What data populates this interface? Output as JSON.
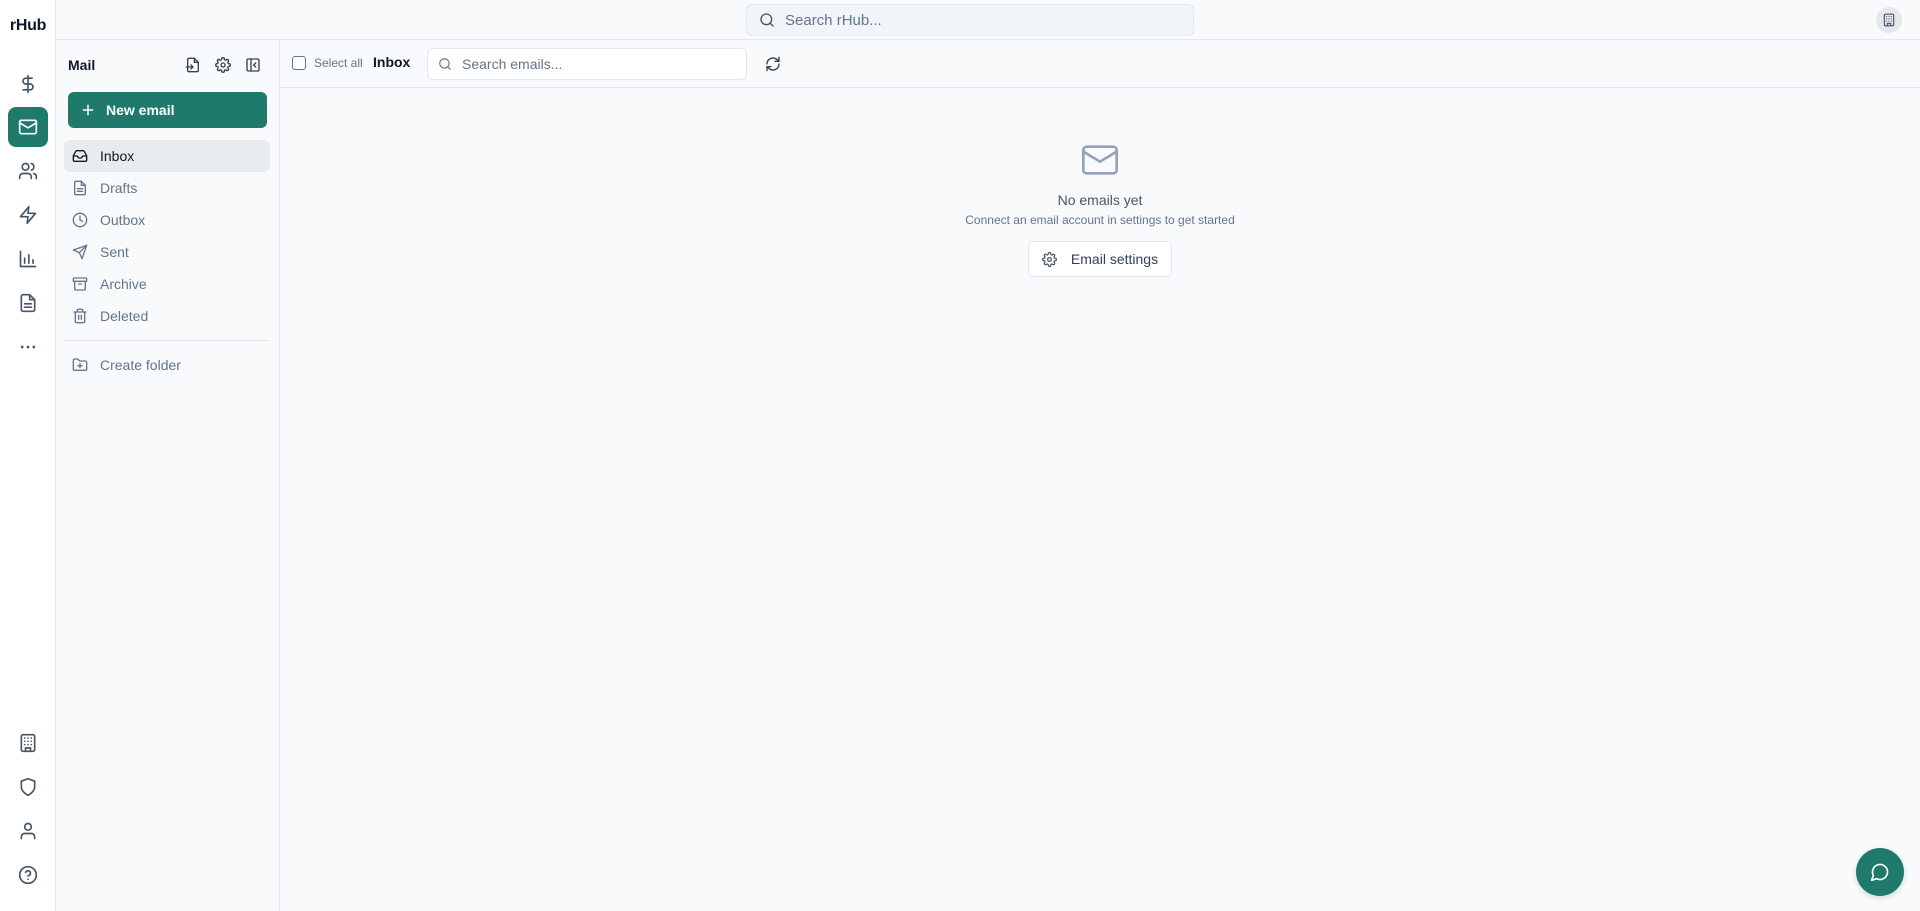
{
  "app": {
    "brand": "rHub"
  },
  "topbar": {
    "search_placeholder": "Search rHub..."
  },
  "rail": {
    "items": [
      {
        "icon": "dollar-icon"
      },
      {
        "icon": "mail-icon",
        "active": true
      },
      {
        "icon": "users-icon"
      },
      {
        "icon": "zap-icon"
      },
      {
        "icon": "bar-chart-icon"
      },
      {
        "icon": "file-text-icon"
      },
      {
        "icon": "more-icon"
      }
    ],
    "bottom": [
      {
        "icon": "building-icon"
      },
      {
        "icon": "shield-icon"
      },
      {
        "icon": "user-icon"
      },
      {
        "icon": "help-icon"
      }
    ]
  },
  "sidebar": {
    "title": "Mail",
    "new_email_label": "New email",
    "folders": [
      {
        "label": "Inbox",
        "icon": "inbox-icon",
        "active": true
      },
      {
        "label": "Drafts",
        "icon": "file-icon"
      },
      {
        "label": "Outbox",
        "icon": "clock-icon"
      },
      {
        "label": "Sent",
        "icon": "send-icon"
      },
      {
        "label": "Archive",
        "icon": "archive-icon"
      },
      {
        "label": "Deleted",
        "icon": "trash-icon"
      }
    ],
    "create_folder_label": "Create folder"
  },
  "toolbar": {
    "select_all_label": "Select all",
    "current_folder": "Inbox",
    "search_placeholder": "Search emails..."
  },
  "empty_state": {
    "title": "No emails yet",
    "subtitle": "Connect an email account in settings to get started",
    "button_label": "Email settings"
  },
  "colors": {
    "accent": "#1f7a6b",
    "background": "#f8fafc"
  }
}
